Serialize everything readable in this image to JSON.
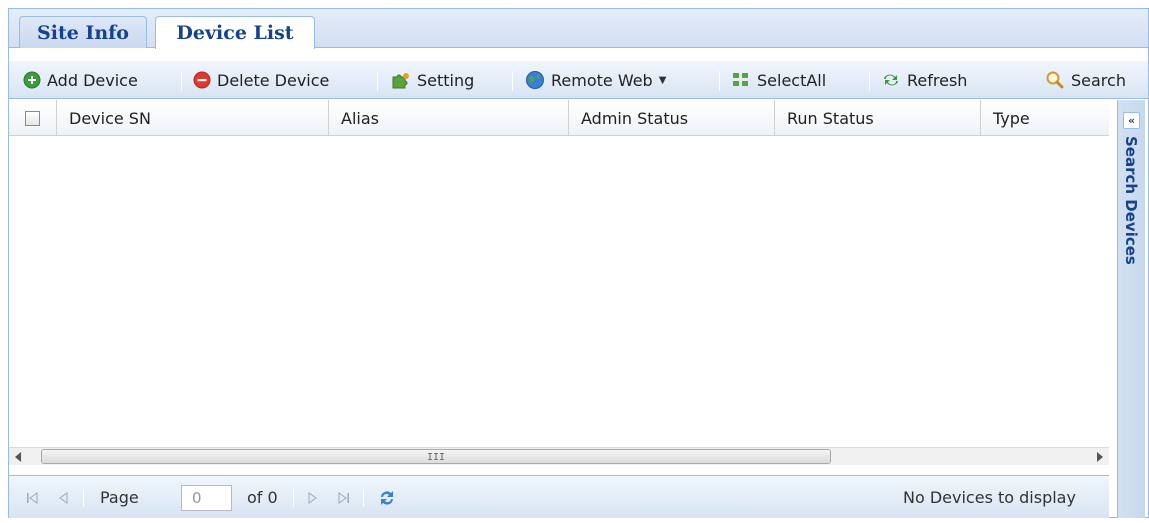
{
  "tabs": [
    {
      "label": "Site Info",
      "active": false
    },
    {
      "label": "Device List",
      "active": true
    }
  ],
  "toolbar": {
    "add_device": "Add Device",
    "delete_device": "Delete Device",
    "setting": "Setting",
    "remote_web": "Remote Web",
    "select_all": "SelectAll",
    "refresh": "Refresh",
    "search": "Search"
  },
  "grid": {
    "columns": [
      "Device SN",
      "Alias",
      "Admin Status",
      "Run Status",
      "Type"
    ],
    "rows": [],
    "scroll_grip": "III"
  },
  "pager": {
    "page_label": "Page",
    "page_value": "0",
    "of_label": "of 0",
    "status": "No Devices to display"
  },
  "east_panel": {
    "title": "Search Devices",
    "expand_glyph": "«"
  },
  "colors": {
    "accent": "#15428b",
    "border": "#99bbe8",
    "add_green": "#3a9b3a",
    "delete_red": "#e0392f"
  }
}
